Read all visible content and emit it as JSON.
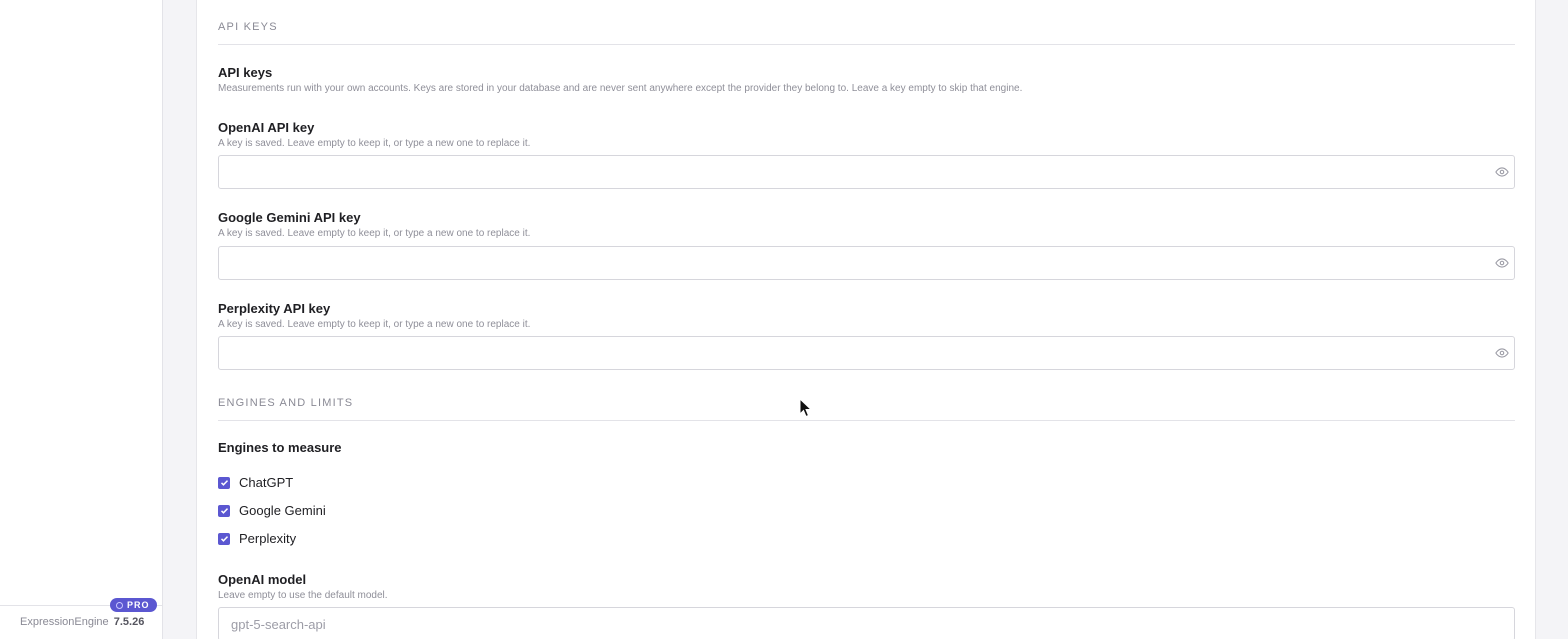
{
  "sidebar": {
    "badge": "PRO",
    "product": "ExpressionEngine",
    "version": "7.5.26"
  },
  "sections": {
    "api_keys_heading": "API KEYS",
    "engines_heading": "ENGINES AND LIMITS"
  },
  "api_keys": {
    "title": "API keys",
    "description": "Measurements run with your own accounts. Keys are stored in your database and are never sent anywhere except the provider they belong to. Leave a key empty to skip that engine.",
    "openai": {
      "label": "OpenAI API key",
      "help": "A key is saved. Leave empty to keep it, or type a new one to replace it.",
      "value": ""
    },
    "gemini": {
      "label": "Google Gemini API key",
      "help": "A key is saved. Leave empty to keep it, or type a new one to replace it.",
      "value": ""
    },
    "perplexity": {
      "label": "Perplexity API key",
      "help": "A key is saved. Leave empty to keep it, or type a new one to replace it.",
      "value": ""
    }
  },
  "engines": {
    "title": "Engines to measure",
    "options": [
      {
        "label": "ChatGPT",
        "checked": true
      },
      {
        "label": "Google Gemini",
        "checked": true
      },
      {
        "label": "Perplexity",
        "checked": true
      }
    ]
  },
  "openai_model": {
    "label": "OpenAI model",
    "help": "Leave empty to use the default model.",
    "placeholder": "gpt-5-search-api",
    "value": ""
  },
  "colors": {
    "accent": "#5b57d1",
    "muted_text": "#8f8f99",
    "border": "#d6d6dc"
  },
  "icons": {
    "reveal": "eye-icon",
    "pointer": "mouse-cursor-icon",
    "check": "check-icon"
  }
}
